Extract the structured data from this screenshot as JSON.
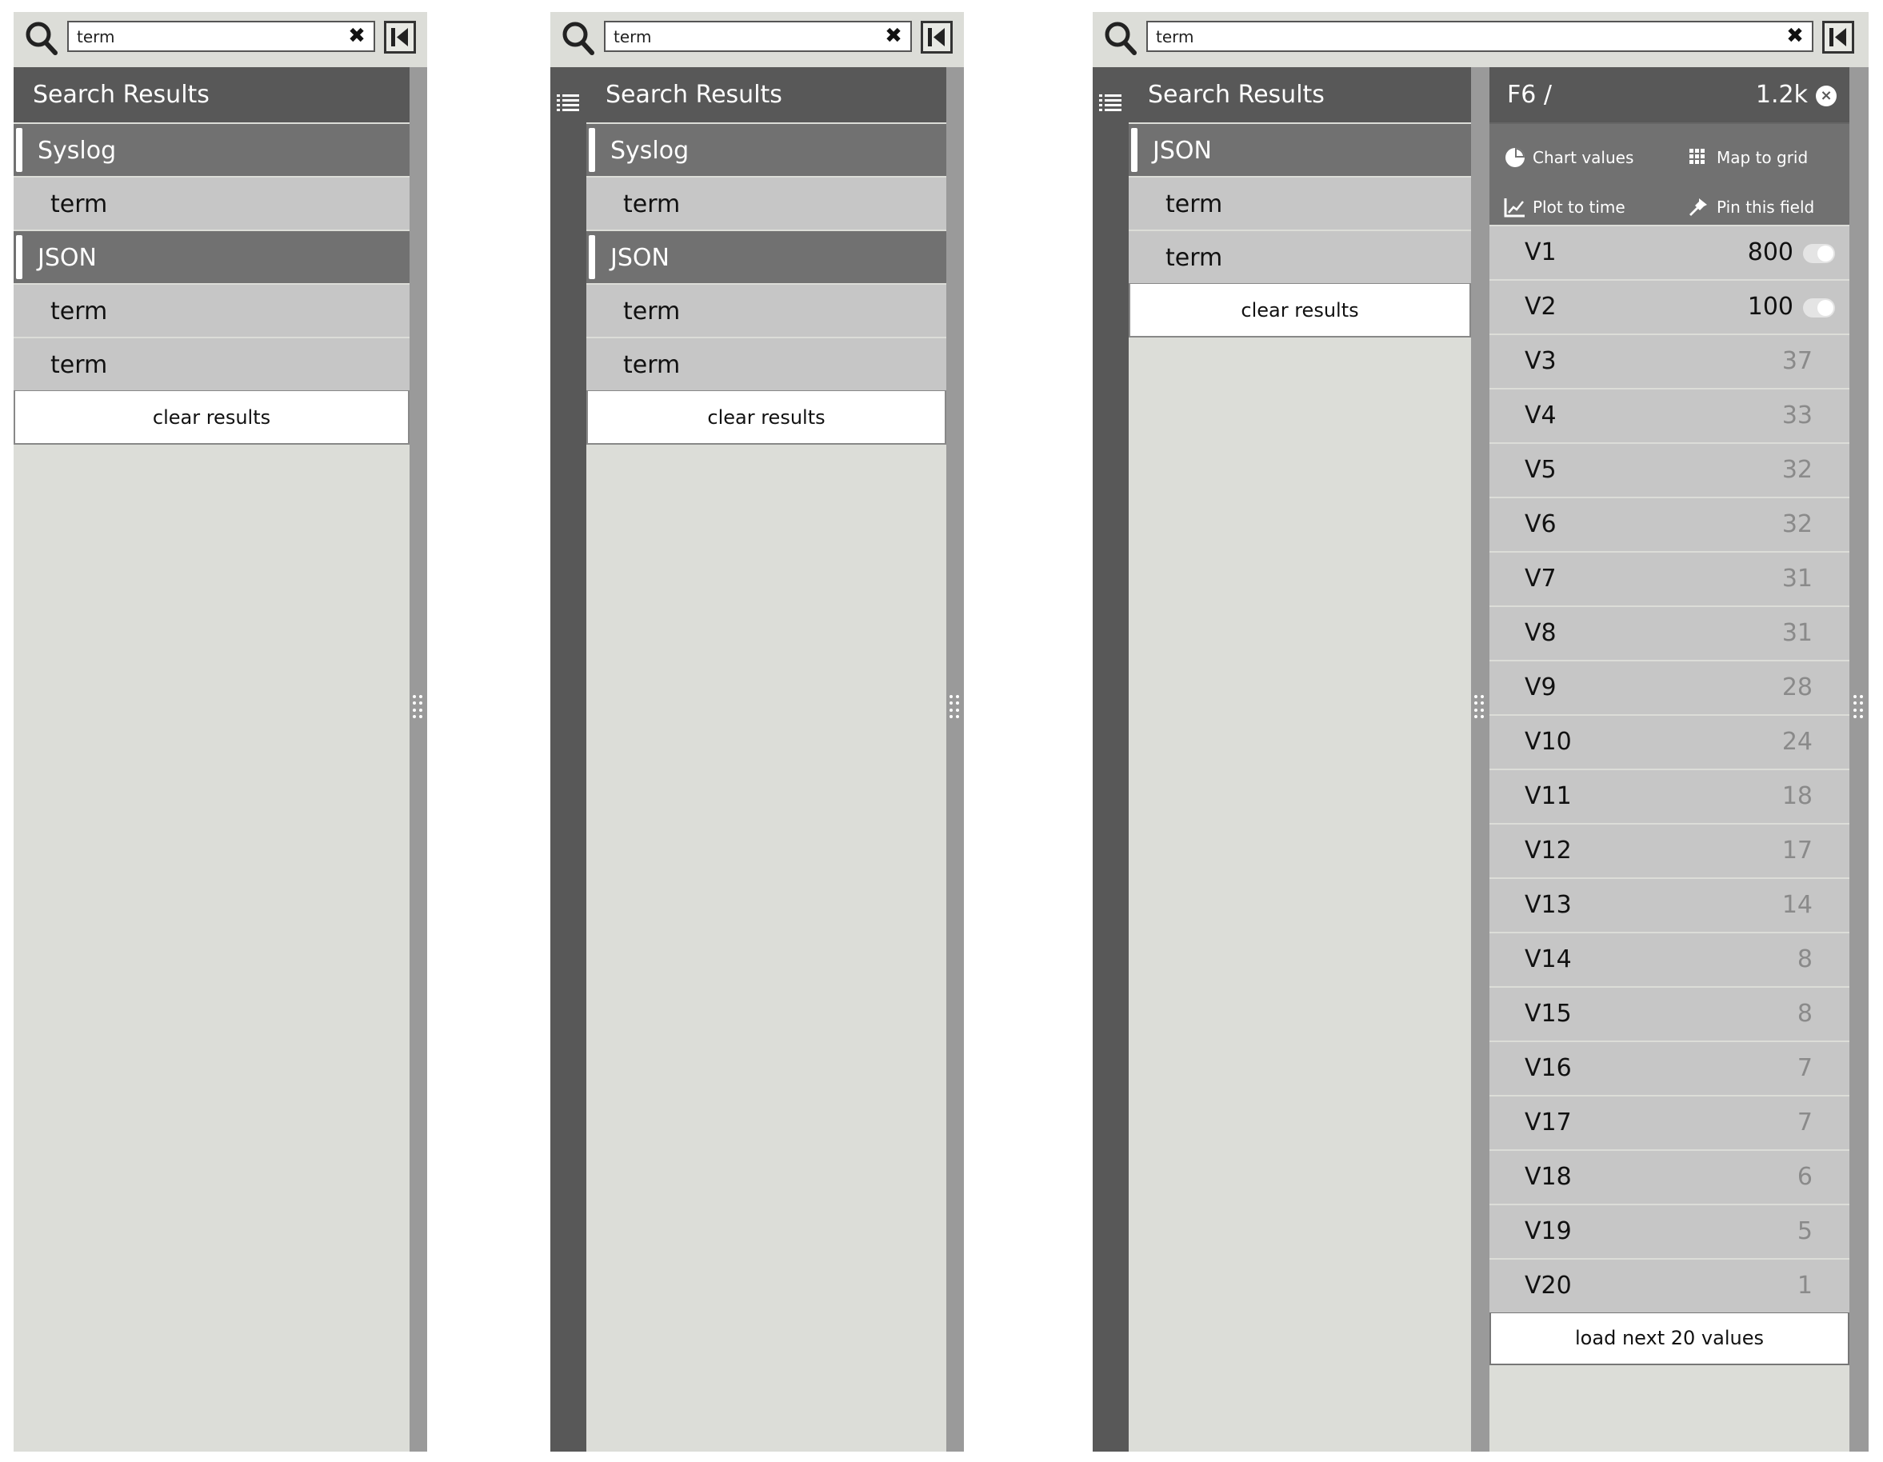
{
  "search": {
    "value": "term",
    "clear_glyph": "✖"
  },
  "results_panel": {
    "header": "Search Results",
    "clear_label": "clear results"
  },
  "panel1": {
    "groups": [
      {
        "label": "Syslog",
        "terms": [
          "term"
        ]
      },
      {
        "label": "JSON",
        "terms": [
          "term",
          "term"
        ]
      }
    ]
  },
  "panel2": {
    "groups": [
      {
        "label": "Syslog",
        "terms": [
          "term"
        ]
      },
      {
        "label": "JSON",
        "terms": [
          "term",
          "term"
        ]
      }
    ]
  },
  "panel3": {
    "groups": [
      {
        "label": "JSON",
        "terms": [
          "term",
          "term"
        ]
      }
    ],
    "field": {
      "title": "F6 /",
      "count": "1.2k",
      "close_glyph": "×",
      "actions": {
        "chart": "Chart values",
        "map": "Map to grid",
        "plot": "Plot to time",
        "pin": "Pin this field"
      },
      "values": [
        {
          "name": "V1",
          "count": "800"
        },
        {
          "name": "V2",
          "count": "100"
        },
        {
          "name": "V3",
          "count": "37"
        },
        {
          "name": "V4",
          "count": "33"
        },
        {
          "name": "V5",
          "count": "32"
        },
        {
          "name": "V6",
          "count": "32"
        },
        {
          "name": "V7",
          "count": "31"
        },
        {
          "name": "V8",
          "count": "31"
        },
        {
          "name": "V9",
          "count": "28"
        },
        {
          "name": "V10",
          "count": "24"
        },
        {
          "name": "V11",
          "count": "18"
        },
        {
          "name": "V12",
          "count": "17"
        },
        {
          "name": "V13",
          "count": "14"
        },
        {
          "name": "V14",
          "count": "8"
        },
        {
          "name": "V15",
          "count": "8"
        },
        {
          "name": "V16",
          "count": "7"
        },
        {
          "name": "V17",
          "count": "7"
        },
        {
          "name": "V18",
          "count": "6"
        },
        {
          "name": "V19",
          "count": "5"
        },
        {
          "name": "V20",
          "count": "1"
        }
      ],
      "load_next": "load next 20 values"
    }
  },
  "colors": {
    "panel_bg": "#dcddd8",
    "header_dark": "#585858",
    "group_row": "#717171",
    "term_row": "#c6c6c6",
    "muted_count": "#8a8a8a"
  },
  "icons": [
    "search-icon",
    "close-icon",
    "collapse-left-icon",
    "list-icon",
    "grip-icon",
    "chart-icon",
    "grid-icon",
    "plot-icon",
    "pin-icon",
    "close-circle-icon",
    "toggle"
  ]
}
